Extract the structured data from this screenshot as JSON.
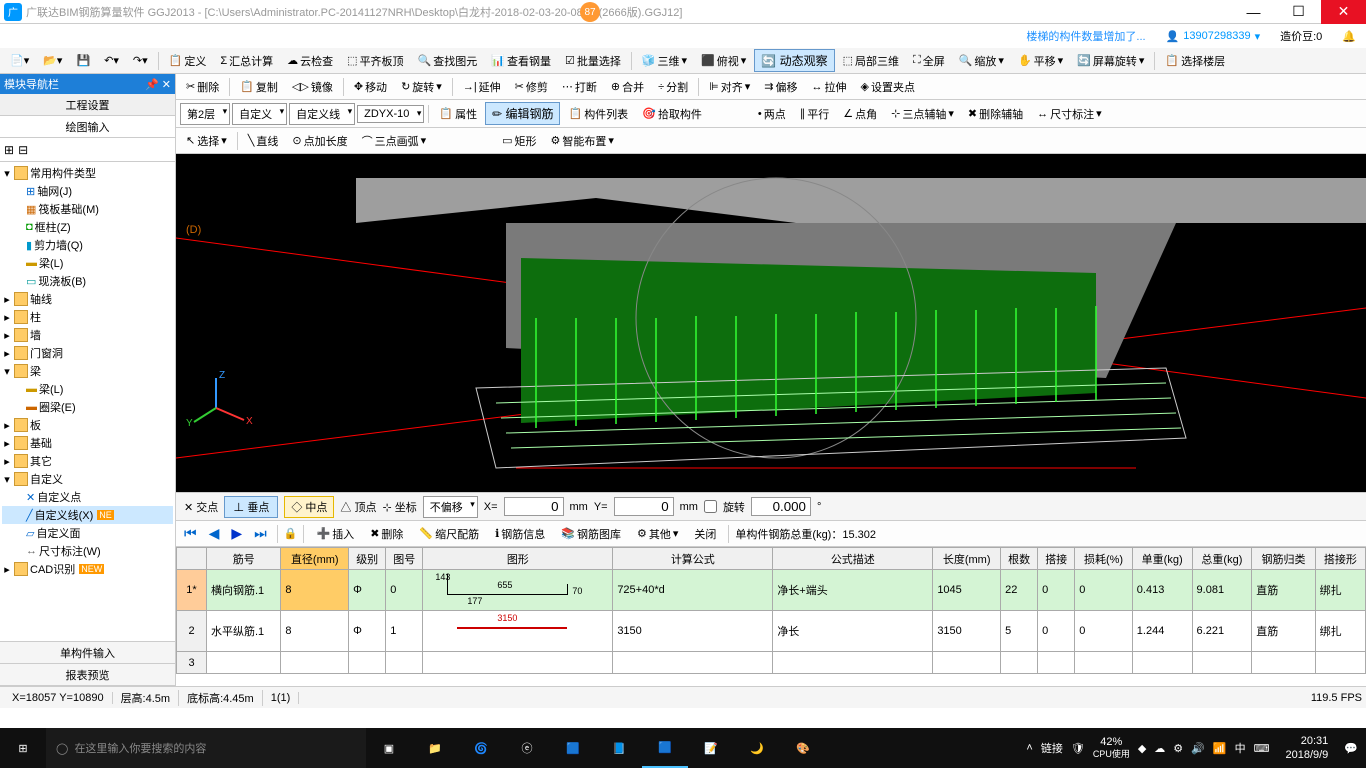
{
  "title": {
    "app": "广联达BIM钢筋算量软件 GGJ2013",
    "path": "[C:\\Users\\Administrator.PC-20141127NRH\\Desktop\\白龙村-2018-02-03-20-08-17(2666版).GGJ12]",
    "badge": "87"
  },
  "notif": {
    "msg": "楼梯的构件数量增加了...",
    "user": "13907298339",
    "coin": "造价豆:0"
  },
  "menu1": {
    "define": "定义",
    "sum": "汇总计算",
    "cloud": "云检查",
    "flat": "平齐板顶",
    "viewer": "查找图元",
    "viewsteel": "查看钢量",
    "batch": "批量选择",
    "threeD": "三维",
    "top": "俯视",
    "dynamic": "动态观察",
    "partial": "局部三维",
    "full": "全屏",
    "zoom": "缩放",
    "pan": "平移",
    "rotate": "屏幕旋转",
    "floor": "选择楼层"
  },
  "menu2": {
    "delete": "删除",
    "copy": "复制",
    "mirror": "镜像",
    "move": "移动",
    "rot": "旋转",
    "extend": "延伸",
    "trim": "修剪",
    "break": "打断",
    "merge": "合并",
    "split": "分割",
    "align": "对齐",
    "offset": "偏移",
    "stretch": "拉伸",
    "fixpt": "设置夹点"
  },
  "menu3": {
    "floor": "第2层",
    "custom": "自定义",
    "customline": "自定义线",
    "code": "ZDYX-10",
    "attr": "属性",
    "editsteel": "编辑钢筋",
    "list": "构件列表",
    "pick": "拾取构件",
    "twopt": "两点",
    "parallel": "平行",
    "angle": "点角",
    "threeax": "三点辅轴",
    "delaxis": "删除辅轴",
    "dim": "尺寸标注"
  },
  "menu4": {
    "select": "选择",
    "line": "直线",
    "addlen": "点加长度",
    "arc": "三点画弧",
    "rect": "矩形",
    "smart": "智能布置"
  },
  "panel": {
    "header": "模块导航栏",
    "tab1": "工程设置",
    "tab2": "绘图输入",
    "bottom1": "单构件输入",
    "bottom2": "报表预览"
  },
  "tree": {
    "n1": "常用构件类型",
    "n1a": "轴网(J)",
    "n1b": "筏板基础(M)",
    "n1c": "框柱(Z)",
    "n1d": "剪力墙(Q)",
    "n1e": "梁(L)",
    "n1f": "现浇板(B)",
    "n2": "轴线",
    "n3": "柱",
    "n4": "墙",
    "n5": "门窗洞",
    "n6": "梁",
    "n6a": "梁(L)",
    "n6b": "圈梁(E)",
    "n7": "板",
    "n8": "基础",
    "n9": "其它",
    "n10": "自定义",
    "n10a": "自定义点",
    "n10b": "自定义线(X)",
    "n10c": "自定义面",
    "n10d": "尺寸标注(W)",
    "n11": "CAD识别"
  },
  "coord": {
    "cross": "交点",
    "perp": "垂点",
    "mid": "中点",
    "vertex": "顶点",
    "coord": "坐标",
    "nooffset": "不偏移",
    "x": "X=",
    "y": "Y=",
    "xval": "0",
    "yval": "0",
    "mm": "mm",
    "rotate": "旋转",
    "rotval": "0.000"
  },
  "tablebar": {
    "insert": "插入",
    "delete": "删除",
    "scale": "缩尺配筋",
    "info": "钢筋信息",
    "lib": "钢筋图库",
    "other": "其他",
    "close": "关闭",
    "total": "单构件钢筋总重(kg)：15.302"
  },
  "table": {
    "h1": "筋号",
    "h2": "直径(mm)",
    "h3": "级别",
    "h4": "图号",
    "h5": "图形",
    "h6": "计算公式",
    "h7": "公式描述",
    "h8": "长度(mm)",
    "h9": "根数",
    "h10": "搭接",
    "h11": "损耗(%)",
    "h12": "单重(kg)",
    "h13": "总重(kg)",
    "h14": "钢筋归类",
    "h15": "搭接形",
    "r1": {
      "n": "1*",
      "name": "横向钢筋.1",
      "dia": "8",
      "lvl": "Φ",
      "fig": "0",
      "g1": "143",
      "g2": "655",
      "g3": "177",
      "g4": "70",
      "formula": "725+40*d",
      "desc": "净长+端头",
      "len": "1045",
      "cnt": "22",
      "lap": "0",
      "loss": "0",
      "uw": "0.413",
      "tw": "9.081",
      "cat": "直筋",
      "lapf": "绑扎"
    },
    "r2": {
      "n": "2",
      "name": "水平纵筋.1",
      "dia": "8",
      "lvl": "Φ",
      "fig": "1",
      "g1": "3150",
      "formula": "3150",
      "desc": "净长",
      "len": "3150",
      "cnt": "5",
      "lap": "0",
      "loss": "0",
      "uw": "1.244",
      "tw": "6.221",
      "cat": "直筋",
      "lapf": "绑扎"
    },
    "r3": {
      "n": "3"
    }
  },
  "status": {
    "xy": "X=18057 Y=10890",
    "fh": "层高:4.5m",
    "bh": "底标高:4.45m",
    "sel": "1(1)",
    "fps": "119.5 FPS"
  },
  "taskbar": {
    "search": "在这里输入你要搜索的内容",
    "link": "链接",
    "cpu": "42%",
    "cpulabel": "CPU使用",
    "ime": "中",
    "time": "20:31",
    "date": "2018/9/9"
  }
}
